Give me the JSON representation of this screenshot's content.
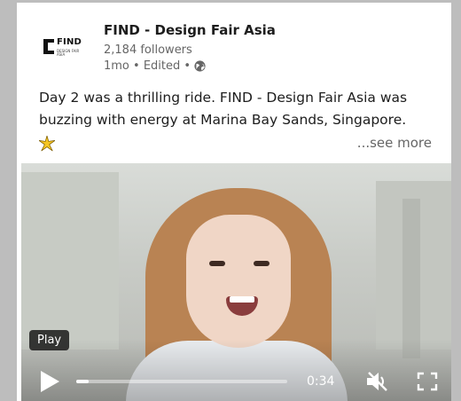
{
  "post": {
    "company_name": "FIND - Design Fair Asia",
    "followers": "2,184 followers",
    "meta": "1mo • Edited •",
    "logo_word": "FIND",
    "logo_sub": "DESIGN FAIR ASIA",
    "text": "Day 2 was a thrilling ride. FIND - Design Fair Asia was buzzing with energy at Marina Bay Sands, Singapore.",
    "see_more": "...see more"
  },
  "video": {
    "play_tooltip": "Play",
    "time": "0:34",
    "progress": 0.06
  },
  "icons": {
    "globe": "globe-icon",
    "sparkle": "sparkle-icon",
    "play": "play-icon",
    "mute": "volume-muted-icon",
    "fullscreen": "fullscreen-icon"
  }
}
